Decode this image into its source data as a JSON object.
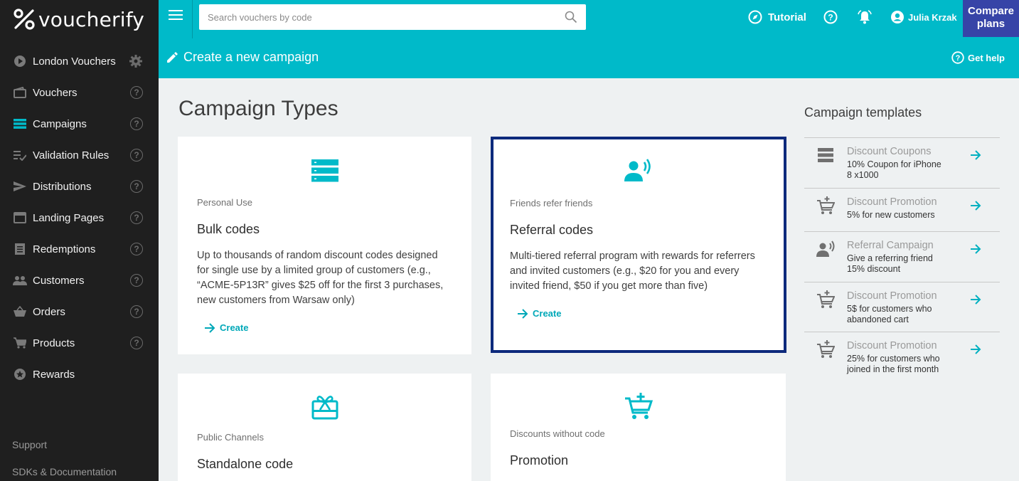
{
  "brand": {
    "name": "voucherify"
  },
  "sidebar": {
    "items": [
      {
        "label": "London Vouchers",
        "icon": "play-circle-icon"
      },
      {
        "label": "Vouchers",
        "icon": "wallet-icon"
      },
      {
        "label": "Campaigns",
        "icon": "list-icon",
        "active": true
      },
      {
        "label": "Validation Rules",
        "icon": "rules-icon"
      },
      {
        "label": "Distributions",
        "icon": "send-icon"
      },
      {
        "label": "Landing Pages",
        "icon": "browser-icon"
      },
      {
        "label": "Redemptions",
        "icon": "receipt-icon"
      },
      {
        "label": "Customers",
        "icon": "people-icon"
      },
      {
        "label": "Orders",
        "icon": "basket-icon"
      },
      {
        "label": "Products",
        "icon": "cart-icon"
      },
      {
        "label": "Rewards",
        "icon": "star-icon"
      }
    ],
    "footer": {
      "support": "Support",
      "docs": "SDKs & Documentation"
    }
  },
  "topbar": {
    "search_placeholder": "Search vouchers by code",
    "tutorial": "Tutorial",
    "user": "Julia Krzak",
    "compare_line1": "Compare",
    "compare_line2": "plans",
    "page_title": "Create a new campaign",
    "get_help": "Get help"
  },
  "main": {
    "title": "Campaign Types",
    "cards": [
      {
        "category": "Personal Use",
        "title": "Bulk codes",
        "description": "Up to thousands of random discount codes designed for single use by a limited group of customers (e.g., “ACME-5P13R” gives $25 off for the first 3 purchases, new customers from Warsaw only)",
        "action": "Create"
      },
      {
        "category": "Friends refer friends",
        "title": "Referral codes",
        "description": "Multi-tiered referral program with rewards for referrers and invited customers (e.g., $20 for you and every invited friend, $50 if you get more than five)",
        "action": "Create",
        "selected": true
      },
      {
        "category": "Public Channels",
        "title": "Standalone code"
      },
      {
        "category": "Discounts without code",
        "title": "Promotion"
      }
    ]
  },
  "templates": {
    "heading": "Campaign templates",
    "items": [
      {
        "title": "Discount Coupons",
        "desc": "10% Coupon for iPhone 8 x1000",
        "icon": "list-icon"
      },
      {
        "title": "Discount Promotion",
        "desc": "5% for new customers",
        "icon": "cart-plus-icon"
      },
      {
        "title": "Referral Campaign",
        "desc": "Give a referring friend 15% discount",
        "icon": "person-voice-icon"
      },
      {
        "title": "Discount Promotion",
        "desc": "5$ for customers who abandoned cart",
        "icon": "cart-plus-icon"
      },
      {
        "title": "Discount Promotion",
        "desc": "25% for customers who joined in the first month",
        "icon": "cart-plus-icon"
      }
    ]
  },
  "colors": {
    "accent": "#00bac9",
    "sidebar": "#1f1f1f",
    "selected_border": "#0d2a7c",
    "compare": "#3744a7"
  }
}
